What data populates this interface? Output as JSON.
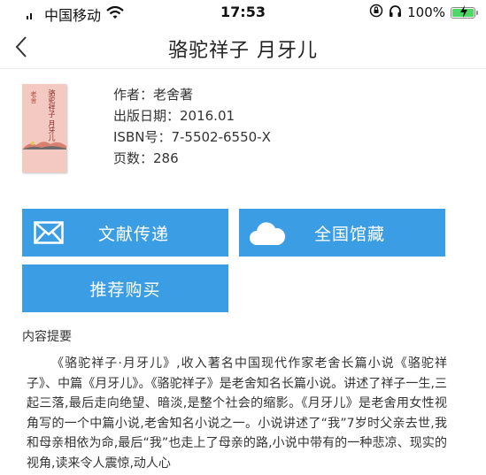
{
  "status_bar": {
    "carrier": "中国移动",
    "time": "17:53",
    "battery_percent": "100%",
    "battery_level": 1.0
  },
  "nav": {
    "title": "骆驼祥子  月牙儿"
  },
  "book": {
    "author": "作者：老舍著",
    "publish_date": "出版日期：2016.01",
    "isbn": "ISBN号：7-5502-6550-X",
    "pages": "页数：286",
    "cover": {
      "author_text": "老舍",
      "title_text": "骆驼祥子 月牙儿"
    }
  },
  "buttons": {
    "document_delivery": "文献传递",
    "national_holdings": "全国馆藏",
    "recommend_purchase": "推荐购买"
  },
  "summary": {
    "heading": "内容提要",
    "text": "《骆驼祥子·月牙儿》,收入著名中国现代作家老舍长篇小说《骆驼祥子》、中篇《月牙儿》。《骆驼祥子》是老舍知名长篇小说。讲述了祥子一生,三起三落,最后走向绝望、暗淡,是整个社会的缩影。《月牙儿》是老舍用女性视角写的一个中篇小说,老舍知名小说之一。小说讲述了“我”7岁时父亲去世,我和母亲相依为命,最后“我”也走上了母亲的路,小说中带有的一种悲凉、现实的视角,读来令人震惊,动人心"
  },
  "colors": {
    "button_blue": "#3b9ee5",
    "battery_green": "#4cd964"
  },
  "icons": {
    "back": "chevron-left-icon",
    "wifi": "wifi-icon",
    "mail": "mail-icon",
    "cloud": "cloud-icon",
    "lock": "orientation-lock-icon",
    "headphones": "headphones-icon",
    "battery": "battery-icon"
  }
}
